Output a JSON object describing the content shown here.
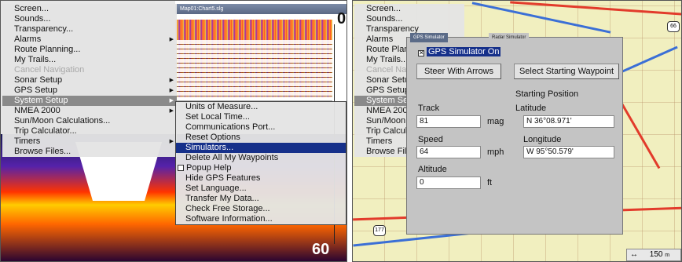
{
  "left": {
    "title_bar": "Map01:Chart5.slg",
    "depth_top": "0",
    "depth_bottom": "60",
    "main_menu": [
      {
        "label": "Screen...",
        "state": "normal",
        "arrow": false
      },
      {
        "label": "Sounds...",
        "state": "normal",
        "arrow": false
      },
      {
        "label": "Transparency...",
        "state": "normal",
        "arrow": false
      },
      {
        "label": "Alarms",
        "state": "normal",
        "arrow": true
      },
      {
        "label": "Route Planning...",
        "state": "normal",
        "arrow": false
      },
      {
        "label": "My Trails...",
        "state": "normal",
        "arrow": false
      },
      {
        "label": "Cancel Navigation",
        "state": "disabled",
        "arrow": false
      },
      {
        "label": "Sonar Setup",
        "state": "normal",
        "arrow": true
      },
      {
        "label": "GPS Setup",
        "state": "normal",
        "arrow": true
      },
      {
        "label": "System Setup",
        "state": "selected",
        "arrow": true
      },
      {
        "label": "NMEA 2000",
        "state": "normal",
        "arrow": true
      },
      {
        "label": "Sun/Moon Calculations...",
        "state": "normal",
        "arrow": false
      },
      {
        "label": "Trip Calculator...",
        "state": "normal",
        "arrow": false
      },
      {
        "label": "Timers",
        "state": "normal",
        "arrow": true
      },
      {
        "label": "Browse Files...",
        "state": "normal",
        "arrow": false
      }
    ],
    "sub_menu": [
      {
        "label": "Units of Measure...",
        "state": "normal"
      },
      {
        "label": "Set Local Time...",
        "state": "normal"
      },
      {
        "label": "Communications Port...",
        "state": "normal"
      },
      {
        "label": "Reset Options",
        "state": "normal"
      },
      {
        "label": "Simulators...",
        "state": "highlight"
      },
      {
        "label": "Delete All My Waypoints",
        "state": "normal"
      },
      {
        "label": "Popup Help",
        "state": "checkbox"
      },
      {
        "label": "Hide GPS Features",
        "state": "normal"
      },
      {
        "label": "Set Language...",
        "state": "normal"
      },
      {
        "label": "Transfer My Data...",
        "state": "normal"
      },
      {
        "label": "Check Free Storage...",
        "state": "normal"
      },
      {
        "label": "Software Information...",
        "state": "normal"
      }
    ]
  },
  "right": {
    "menu": [
      {
        "label": "Screen...",
        "state": "normal"
      },
      {
        "label": "Sounds...",
        "state": "normal"
      },
      {
        "label": "Transparency",
        "state": "normal"
      },
      {
        "label": "Alarms",
        "state": "normal"
      },
      {
        "label": "Route Planning",
        "state": "normal"
      },
      {
        "label": "My Trails...",
        "state": "normal"
      },
      {
        "label": "Cancel Navi",
        "state": "disabled"
      },
      {
        "label": "Sonar Setup",
        "state": "normal"
      },
      {
        "label": "GPS Setup",
        "state": "normal"
      },
      {
        "label": "System Se",
        "state": "selected"
      },
      {
        "label": "NMEA 200",
        "state": "normal"
      },
      {
        "label": "Sun/Moon",
        "state": "normal"
      },
      {
        "label": "Trip Calcula",
        "state": "normal"
      },
      {
        "label": "Timers",
        "state": "normal"
      },
      {
        "label": "Browse File",
        "state": "normal"
      }
    ],
    "simulator": {
      "tab_gps": "GPS Simulator",
      "tab_radar": "Radar Simulator",
      "gps_on_label": "GPS Simulator On",
      "steer_button": "Steer With Arrows",
      "start_button": "Select Starting Waypoint",
      "starting_position": "Starting Position",
      "track_label": "Track",
      "track_value": "81",
      "track_unit": "mag",
      "speed_label": "Speed",
      "speed_value": "64",
      "speed_unit": "mph",
      "altitude_label": "Altitude",
      "altitude_value": "0",
      "altitude_unit": "ft",
      "latitude_label": "Latitude",
      "latitude_value": "N   36°08.971'",
      "longitude_label": "Longitude",
      "longitude_value": "W   95°50.579'"
    },
    "scale": "150",
    "scale_unit": "m",
    "highway_shields": [
      "66",
      "177"
    ]
  },
  "colors": {
    "menu_highlight": "#16308a",
    "menu_selected": "#8a8a8a",
    "map_background": "#f1efbf",
    "dialog_background": "#c4c4c4"
  }
}
